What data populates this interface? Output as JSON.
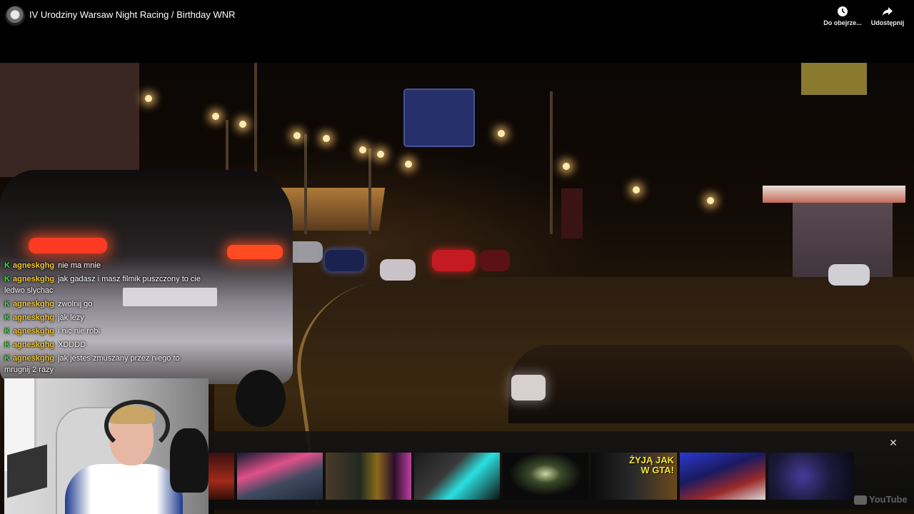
{
  "header": {
    "title": "IV Urodziny Warsaw Night Racing / Birthday WNR",
    "actions": [
      {
        "label": "Do obejrze...",
        "icon": "clock-icon"
      },
      {
        "label": "Udostępnij",
        "icon": "share-arrow-icon"
      }
    ]
  },
  "chat": {
    "messages": [
      {
        "user": "agneskghg",
        "text": "nie ma mnie"
      },
      {
        "user": "agneskghg",
        "text": "jak gadasz i masz filmik puszczony to cie ledwo slychac"
      },
      {
        "user": "agneskghg",
        "text": "zwolnij go"
      },
      {
        "user": "agneskghg",
        "text": "jak lezy"
      },
      {
        "user": "agneskghg",
        "text": "i nic nie robi"
      },
      {
        "user": "agneskghg",
        "text": "XDDDD"
      },
      {
        "user": "agneskghg",
        "text": "jak jestes zmuszany przez niego to mrugnij 2 razy"
      }
    ],
    "badge_color": "#2ee82e",
    "user_color": "#f0c93a"
  },
  "endscreen": {
    "close_icon": "close-icon",
    "thumbnails": [
      {
        "overlay_text": ""
      },
      {
        "overlay_text": ""
      },
      {
        "overlay_text": ""
      },
      {
        "overlay_text": ""
      },
      {
        "overlay_text": ""
      },
      {
        "overlay_text": "ŻYJĄ JAK W GTA!"
      },
      {
        "overlay_text": ""
      },
      {
        "overlay_text": ""
      }
    ]
  },
  "watermark": {
    "text": "YouTube"
  },
  "colors": {
    "background": "#000000",
    "accent_yellow": "#f7e63a"
  }
}
